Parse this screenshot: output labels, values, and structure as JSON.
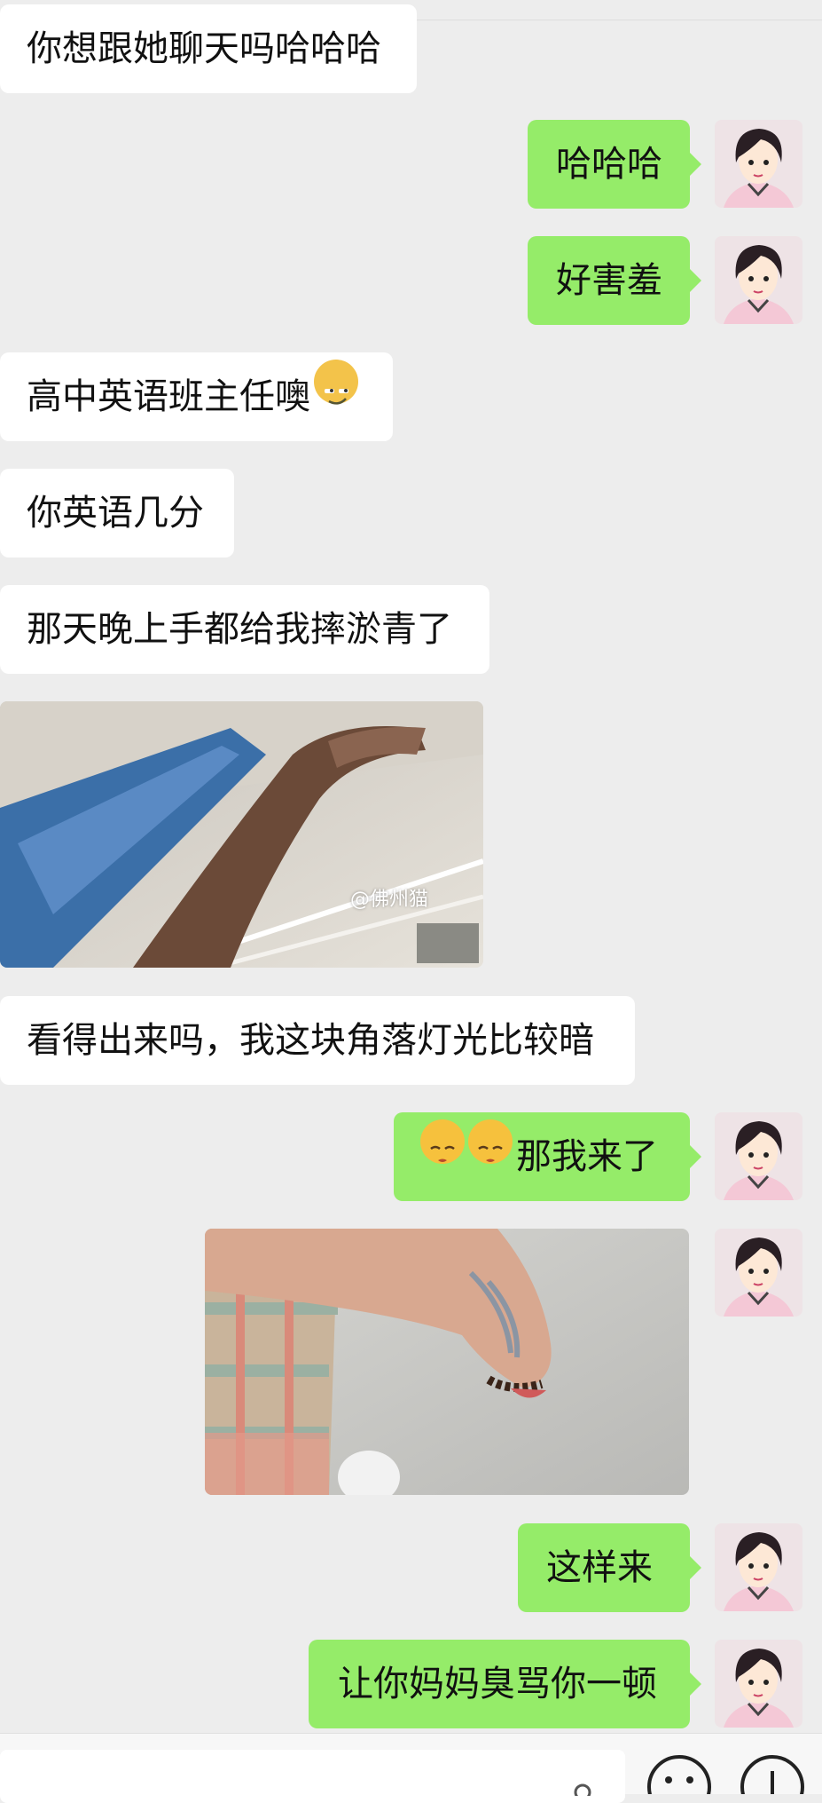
{
  "messages": [
    {
      "side": "left",
      "text": "你想跟她聊天吗哈哈哈"
    },
    {
      "side": "right",
      "text": "哈哈哈"
    },
    {
      "side": "right",
      "text": "好害羞"
    },
    {
      "side": "left",
      "text": "高中英语班主任噢",
      "emoji": "smirking-cat-emoji"
    },
    {
      "side": "left",
      "text": "你英语几分"
    },
    {
      "side": "left",
      "text": "那天晚上手都给我摔淤青了"
    },
    {
      "side": "left",
      "type": "image",
      "watermark": "@佛州猫"
    },
    {
      "side": "left",
      "text": "看得出来吗，我这块角落灯光比较暗"
    },
    {
      "side": "right",
      "text": "那我来了",
      "emoji": "kissing-emoji x2"
    },
    {
      "side": "right",
      "type": "image"
    },
    {
      "side": "right",
      "text": "这样来"
    },
    {
      "side": "right",
      "text": "让你妈妈臭骂你一顿"
    }
  ],
  "colors": {
    "background": "#ededed",
    "sent_bubble": "#95ec69",
    "received_bubble": "#ffffff"
  }
}
